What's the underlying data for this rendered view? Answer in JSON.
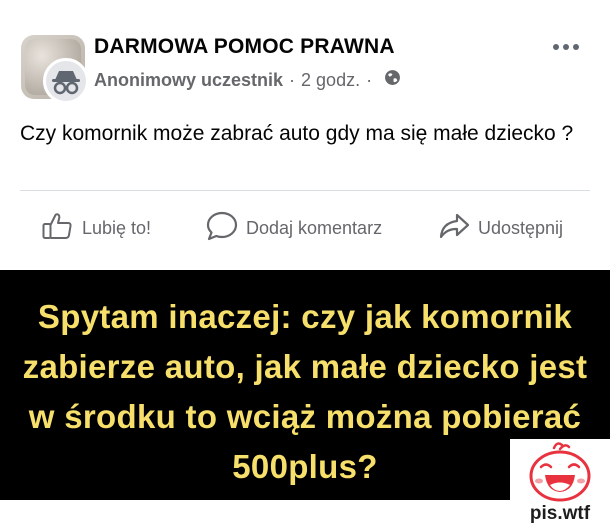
{
  "post": {
    "group_name": "DARMOWA POMOC PRAWNA",
    "author": "Anonimowy uczestnik",
    "separator": "·",
    "time": "2 godz.",
    "time_separator": "·",
    "privacy_icon": "globe-icon",
    "more_icon": "more-options-icon",
    "text": "Czy komornik może zabrać auto gdy ma się małe dziecko ?"
  },
  "actions": {
    "like_label": "Lubię to!",
    "comment_label": "Dodaj komentarz",
    "share_label": "Udostępnij"
  },
  "banner": {
    "text": "Spytam inaczej: czy jak komornik zabierze auto, jak małe dziecko jest w środku to wciąż można pobierać 500plus?",
    "text_color": "#f6df6a",
    "background": "#000000"
  },
  "watermark": {
    "logo_icon": "laughing-face-logo",
    "text": "pis.wtf",
    "color": "#e8333f"
  }
}
